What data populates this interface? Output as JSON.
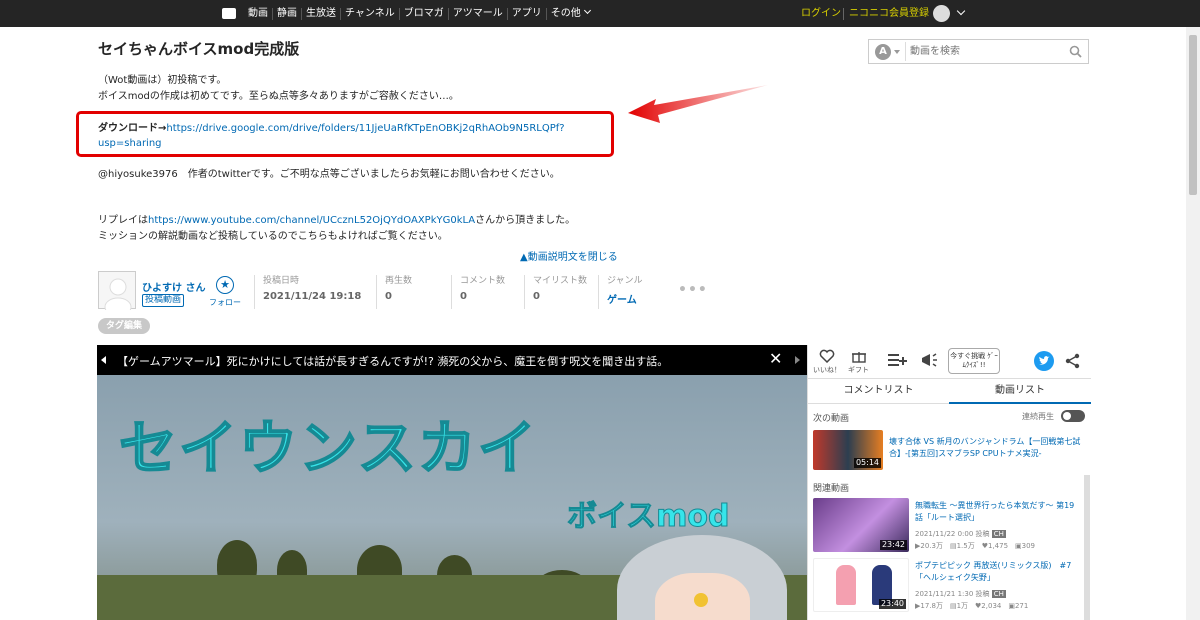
{
  "nav": {
    "items": [
      "動画",
      "静画",
      "生放送",
      "チャンネル",
      "ブロマガ",
      "アツマール",
      "アプリ",
      "その他"
    ],
    "login": "ログイン",
    "register": "ニコニコ会員登録"
  },
  "video": {
    "title": "セイちゃんボイスmod完成版",
    "desc_line1": "（Wot動画は）初投稿です。",
    "desc_line2": "ボイスmodの作成は初めてです。至らぬ点等多々ありますがご容赦ください…。",
    "download_label": "ダウンロード→",
    "download_url1": "https://drive.google.com/drive/folders/11JjeUaRfKTpEnOBKj2qRhAOb9N5RLQPf?",
    "download_url2": "usp=sharing",
    "twitter_line": "@hiyosuke3976　作者のtwitterです。ご不明な点等ございましたらお気軽にお問い合わせください。",
    "replay_prefix": "リプレイは",
    "replay_url": "https://www.youtube.com/channel/UCcznL52OjQYdOAXPkYG0kLA",
    "replay_suffix": "さんから頂きました。",
    "mission_line": "ミッションの解説動画など投稿しているのでこちらもよければご覧ください。",
    "close_desc": "▲動画説明文を閉じる"
  },
  "search": {
    "placeholder": "動画を検索",
    "mode_letter": "A"
  },
  "uploader": {
    "name": "ひよすけ さん",
    "badge": "投稿動画",
    "follow": "フォロー",
    "follow_icon": "★"
  },
  "stats": {
    "posted_label": "投稿日時",
    "posted": "2021/11/24 19:18",
    "views_label": "再生数",
    "views": "0",
    "comments_label": "コメント数",
    "comments": "0",
    "mylist_label": "マイリスト数",
    "mylist": "0",
    "genre_label": "ジャンル",
    "genre": "ゲーム",
    "more": "•••"
  },
  "tag_edit": "タグ編集",
  "player": {
    "banner_title": "【ゲームアツマール】死にかけにしては話が長すぎるんですが!? 瀕死の父から、魔王を倒す呪文を聞き出す話。",
    "close": "✕",
    "big_text": "セイウンスカイ",
    "sub_text": "ボイスmod"
  },
  "side": {
    "like": "いいね！",
    "gift": "ギフト",
    "quiz": "今すぐ挑戦 ｹﾞｰﾑｸｲｽﾞ!!",
    "tab_comments": "コメントリスト",
    "tab_videos": "動画リスト",
    "next_label": "次の動画",
    "autoplay": "連続再生",
    "related_label": "関連動画",
    "next_video": {
      "title1": "壊す合体 VS 新月のバンジャンドラム【一回戦第七試",
      "title2": "合】-[第五回]スマブラSP CPUトナメ実況-",
      "duration": "05:14"
    },
    "related": [
      {
        "title1": "無職転生 ～異世界行ったら本気だす～ 第19",
        "title2": "話「ルート選択」",
        "date": "2021/11/22 0:00 投稿",
        "badge": "CH",
        "stats": "▶20.3万　▤1.5万　♥1,475　▣309",
        "duration": "23:42"
      },
      {
        "title1": "ポプテピピック 再放送(リミックス版)　#7",
        "title2": "「ヘルシェイク矢野」",
        "date": "2021/11/21 1:30 投稿",
        "badge": "CH",
        "stats": "▶17.8万　▤1万　♥2,034　▣271",
        "duration": "23:40"
      }
    ]
  },
  "colors": {
    "accent": "#0069b3",
    "topbar": "#252525",
    "highlight_box": "#e20000",
    "title_text": "#36e5ea"
  }
}
